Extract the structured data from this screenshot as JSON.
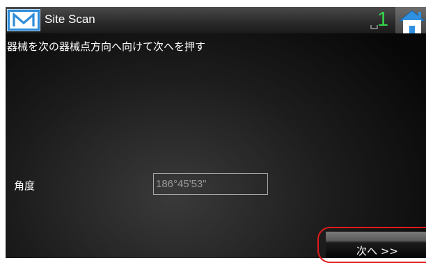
{
  "app": {
    "logo_letter": "M",
    "title": "Site Scan"
  },
  "status": {
    "satellite_count": "1",
    "count_color": "#35d44c"
  },
  "nav": {
    "home_icon": "home-icon"
  },
  "instruction": "器械を次の器械点方向へ向けて次へを押す",
  "angle": {
    "label": "角度",
    "value": "186°45'53\""
  },
  "buttons": {
    "next_label": "次へ >>"
  },
  "colors": {
    "logo_blue": "#2f8cd8",
    "highlight_red": "#e21b1b"
  }
}
